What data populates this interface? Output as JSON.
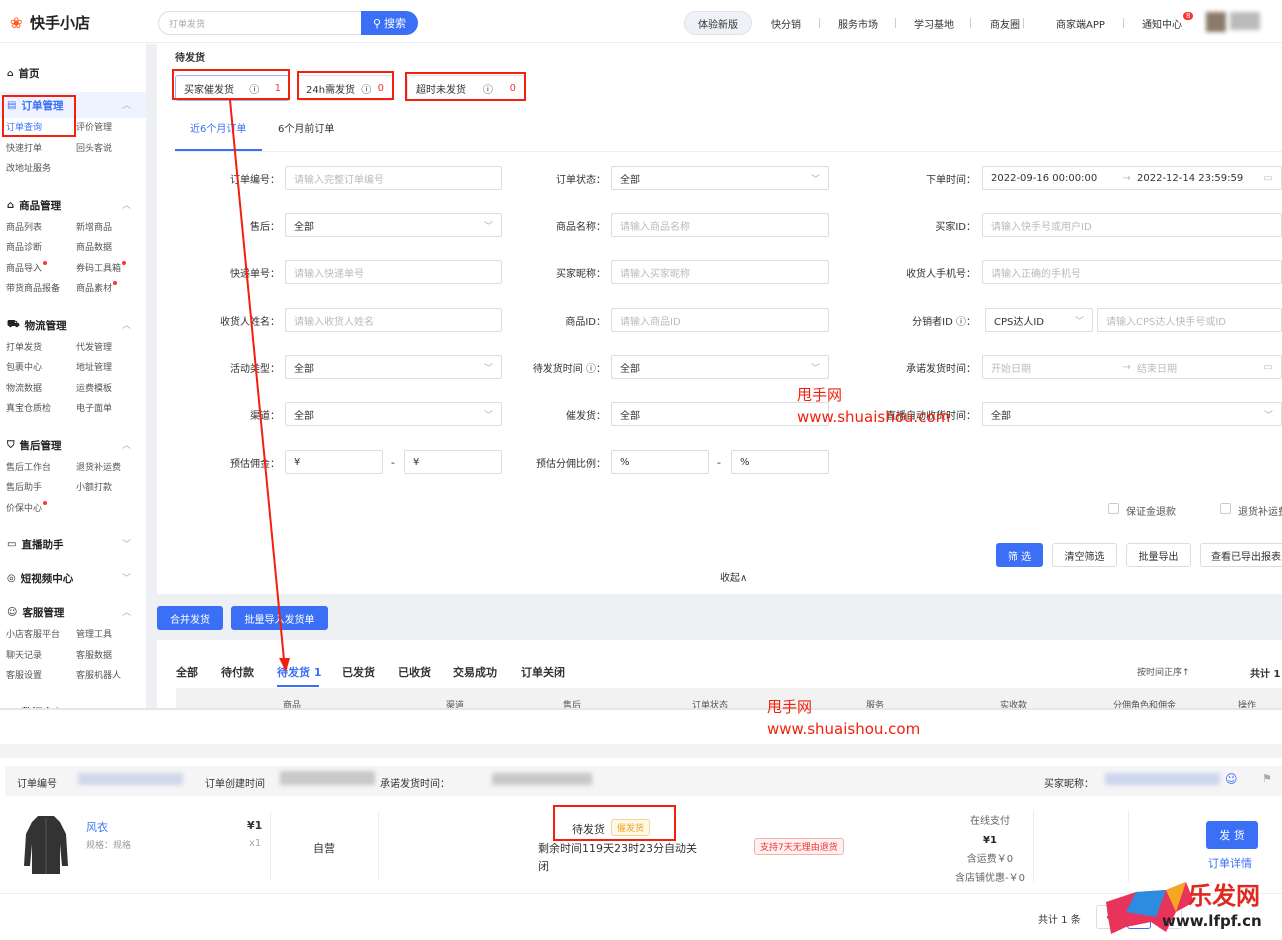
{
  "header": {
    "brand": "快手小店",
    "search_placeholder": "打单发货",
    "search_button": "搜索",
    "try_new": "体验新版",
    "nav": [
      "快分销",
      "服务市场",
      "学习基地",
      "商友圈",
      "商家端APP",
      "通知中心"
    ],
    "notification_count": "8"
  },
  "sidebar": {
    "home": "首页",
    "groups": [
      {
        "title": "订单管理",
        "icon": "order-icon",
        "expanded": true,
        "active": true,
        "items": [
          {
            "label": "订单查询",
            "active": true
          },
          {
            "label": "评价管理"
          },
          {
            "label": "快速打单"
          },
          {
            "label": "回头客说"
          },
          {
            "label": "改地址服务"
          }
        ]
      },
      {
        "title": "商品管理",
        "icon": "bag-icon",
        "expanded": true,
        "items": [
          {
            "label": "商品列表"
          },
          {
            "label": "新增商品"
          },
          {
            "label": "商品诊断"
          },
          {
            "label": "商品数据"
          },
          {
            "label": "商品导入",
            "dot": true
          },
          {
            "label": "券码工具箱",
            "dot": true
          },
          {
            "label": "带货商品报备"
          },
          {
            "label": "商品素材",
            "dot": true
          }
        ]
      },
      {
        "title": "物流管理",
        "icon": "truck-icon",
        "expanded": true,
        "items": [
          {
            "label": "打单发货"
          },
          {
            "label": "代发管理"
          },
          {
            "label": "包裹中心"
          },
          {
            "label": "地址管理"
          },
          {
            "label": "物流数据"
          },
          {
            "label": "运费模板"
          },
          {
            "label": "真宝仓质检"
          },
          {
            "label": "电子面单"
          }
        ]
      },
      {
        "title": "售后管理",
        "icon": "shield-icon",
        "expanded": true,
        "items": [
          {
            "label": "售后工作台"
          },
          {
            "label": "退货补运费"
          },
          {
            "label": "售后助手"
          },
          {
            "label": "小额打款"
          },
          {
            "label": "价保中心",
            "dot": true
          }
        ]
      },
      {
        "title": "直播助手",
        "icon": "video-icon",
        "expanded": false,
        "items": []
      },
      {
        "title": "短视频中心",
        "icon": "film-icon",
        "expanded": false,
        "items": []
      },
      {
        "title": "客服管理",
        "icon": "chat-icon",
        "expanded": true,
        "items": [
          {
            "label": "小店客服平台"
          },
          {
            "label": "管理工具"
          },
          {
            "label": "聊天记录"
          },
          {
            "label": "客服数据"
          },
          {
            "label": "客服设置"
          },
          {
            "label": "客服机器人"
          }
        ]
      },
      {
        "title": "数据中心",
        "icon": "chart-icon",
        "expanded": true,
        "items": []
      }
    ]
  },
  "page": {
    "title": "待发货",
    "cards": [
      {
        "label": "买家催发货",
        "count": "1"
      },
      {
        "label": "24h需发货",
        "count": "0"
      },
      {
        "label": "超时未发货",
        "count": "0"
      }
    ],
    "range_tabs": [
      {
        "label": "近6个月订单",
        "active": true
      },
      {
        "label": "6个月前订单"
      }
    ]
  },
  "filters": [
    [
      {
        "label": "订单编号",
        "type": "input",
        "placeholder": "请输入完整订单编号"
      },
      {
        "label": "售后",
        "type": "select",
        "value": "全部"
      },
      {
        "label": "快递单号",
        "type": "input",
        "placeholder": "请输入快递单号"
      },
      {
        "label": "收货人姓名",
        "type": "input",
        "placeholder": "请输入收货人姓名"
      },
      {
        "label": "活动类型",
        "type": "select",
        "value": "全部"
      },
      {
        "label": "渠道",
        "type": "select",
        "value": "全部"
      },
      {
        "label": "预估佣金",
        "type": "range",
        "from": "¥",
        "to": "¥"
      }
    ],
    [
      {
        "label": "订单状态",
        "type": "select",
        "value": "全部"
      },
      {
        "label": "商品名称",
        "type": "input",
        "placeholder": "请输入商品名称"
      },
      {
        "label": "买家昵称",
        "type": "input",
        "placeholder": "请输入买家昵称"
      },
      {
        "label": "商品ID",
        "type": "input",
        "placeholder": "请输入商品ID"
      },
      {
        "label": "待发货时间",
        "help": true,
        "type": "select",
        "value": "全部"
      },
      {
        "label": "催发货",
        "type": "value",
        "value": "全部"
      },
      {
        "label": "预估分佣比例",
        "type": "range",
        "from": "%",
        "to": "%"
      }
    ],
    [
      {
        "label": "下单时间",
        "type": "date",
        "from": "2022-09-16 00:00:00",
        "to": "2022-12-14 23:59:59"
      },
      {
        "label": "买家ID",
        "type": "input",
        "placeholder": "请输入快手号或用户ID"
      },
      {
        "label": "收货人手机号",
        "type": "input",
        "placeholder": "请输入正确的手机号"
      },
      {
        "label": "分销者ID",
        "help": true,
        "type": "combo",
        "value": "CPS达人ID",
        "placeholder": "请输入CPS达人快手号或ID"
      },
      {
        "label": "承诺发货时间",
        "type": "date",
        "from_placeholder": "开始日期",
        "to_placeholder": "结束日期"
      },
      {
        "label": "直播自动收货时间",
        "type": "select",
        "value": "全部"
      }
    ]
  ],
  "checkboxes": [
    {
      "label": "保证金退款",
      "checked": false
    },
    {
      "label": "退货补运费",
      "checked": false
    }
  ],
  "actions": {
    "filter": "筛 选",
    "clear": "清空筛选",
    "export": "批量导出",
    "view_exports": "查看已导出报表",
    "collapse": "收起∧"
  },
  "bulk": {
    "merge": "合并发货",
    "import": "批量导入发货单"
  },
  "order_tabs": [
    {
      "label": "全部"
    },
    {
      "label": "待付款"
    },
    {
      "label": "待发货 1",
      "active": true
    },
    {
      "label": "已发货"
    },
    {
      "label": "已收货"
    },
    {
      "label": "交易成功"
    },
    {
      "label": "订单关闭"
    }
  ],
  "sort": "按时间正序↑",
  "total": "共计 1",
  "columns": [
    "商品",
    "渠道",
    "售后",
    "订单状态",
    "服务",
    "实收款",
    "分佣角色和佣金",
    "操作"
  ],
  "order": {
    "no_label": "订单编号",
    "created_label": "订单创建时间",
    "promise_label": "承诺发货时间：",
    "buyer_label": "买家昵称：",
    "product": "风衣",
    "spec": "规格：规格",
    "price": "¥1",
    "qty": "x1",
    "channel": "自营",
    "status": "待发货",
    "urge_badge": "催发货",
    "remaining": "剩余时间119天23时23分自动关闭",
    "service_badge": "支持7天无理由退货",
    "pay_method": "在线支付",
    "paid": "¥1",
    "shipping": "含运费￥0",
    "discount": "含店铺优惠-￥0",
    "ship_button": "发 货",
    "detail_link": "订单详情"
  },
  "pagination": {
    "total": "共计 1 条",
    "current": "1"
  },
  "watermarks": [
    {
      "line1": "甩手网",
      "line2": "www.shuaishou.com"
    },
    {
      "line1": "甩手网",
      "line2": "www.shuaishou.com"
    }
  ],
  "corner_logo": {
    "title": "乐发网",
    "url": "www.lfpf.cn"
  },
  "colors": {
    "primary": "#3b6ff5",
    "annotation": "#f2200d",
    "danger": "#ff3333"
  }
}
